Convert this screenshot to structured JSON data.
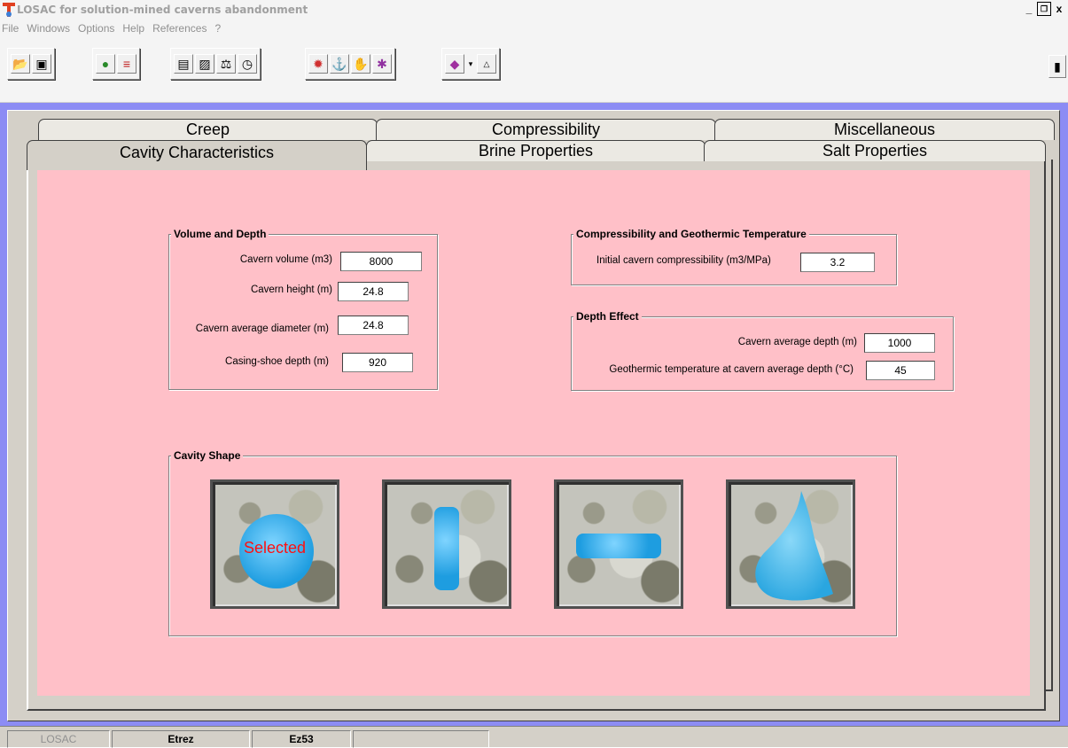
{
  "window": {
    "title": "LOSAC for solution-mined caverns abandonment",
    "controls": [
      "_",
      "̵",
      "x"
    ]
  },
  "menu": [
    "File",
    "Windows",
    "Options",
    "Help",
    "References",
    "?"
  ],
  "toolbar": {
    "groups": [
      [
        "open-folder-icon",
        "save-disk-icon"
      ],
      [
        "globe-icon",
        "us-flag-icon"
      ],
      [
        "table-icon",
        "chart-icon",
        "balance-scale-icon",
        "stopwatch-icon"
      ],
      [
        "explosion-icon",
        "pressure-gauge-icon",
        "hand-icon",
        "particles-icon"
      ],
      [
        "book-icon",
        "dropdown-arrow-icon",
        "resolution-icon"
      ]
    ],
    "exit_icon": "exit-door-icon"
  },
  "tabs": {
    "top_row": [
      "Creep",
      "Compressibility",
      "Miscellaneous"
    ],
    "bottom_row": [
      "Cavity Characteristics",
      "Brine Properties",
      "Salt Properties"
    ],
    "active": "Cavity Characteristics"
  },
  "volume_depth": {
    "title": "Volume and Depth",
    "fields": [
      {
        "label": "Cavern volume (m3)",
        "value": "8000"
      },
      {
        "label": "Cavern height (m)",
        "value": "24.8"
      },
      {
        "label": "Cavern average diameter (m)",
        "value": "24.8"
      },
      {
        "label": "Casing-shoe depth (m)",
        "value": "920"
      }
    ]
  },
  "compressibility": {
    "title": "Compressibility and Geothermic Temperature",
    "label": "Initial cavern compressibility (m3/MPa)",
    "value": "3.2"
  },
  "depth_effect": {
    "title": "Depth Effect",
    "fields": [
      {
        "label": "Cavern average depth (m)",
        "value": "1000"
      },
      {
        "label": "Geothermic temperature at cavern average depth (°C)",
        "value": "45"
      }
    ]
  },
  "cavity_shape": {
    "title": "Cavity Shape",
    "selected_label": "Selected",
    "shapes": [
      "sphere",
      "vertical-cylinder",
      "horizontal-cylinder",
      "pear"
    ],
    "selected_index": 0
  },
  "status": [
    "LOSAC",
    "Etrez",
    "Ez53",
    ""
  ],
  "colors": {
    "desktop": "#8c8cf4",
    "content": "#ffc0c8",
    "cavity": "#1e9de0",
    "selected_text": "#ff1010"
  }
}
